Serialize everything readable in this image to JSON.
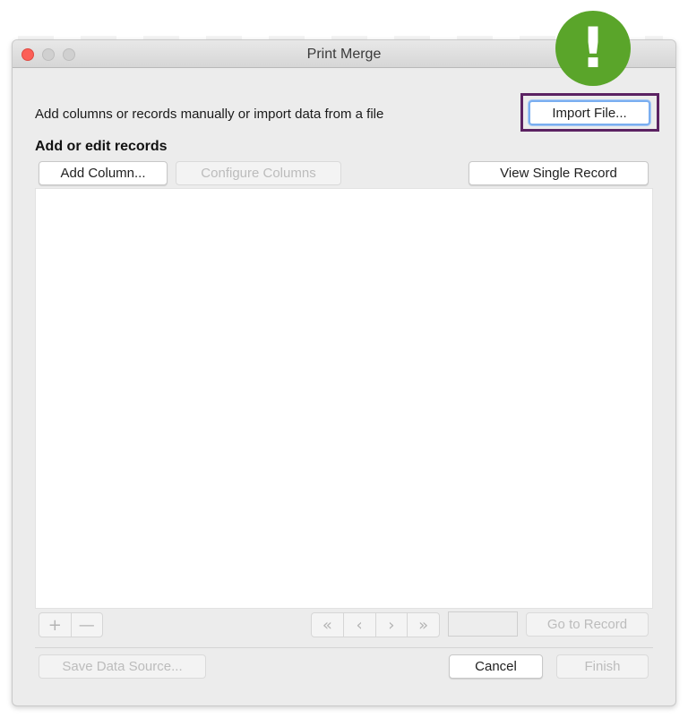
{
  "window": {
    "title": "Print Merge"
  },
  "intro_text": "Add columns or records manually or import data from a file",
  "import_button": "Import File...",
  "section_title": "Add or edit records",
  "toolbar": {
    "add_column": "Add Column...",
    "configure_columns": "Configure Columns",
    "view_single_record": "View Single Record"
  },
  "records_list": {
    "rows": []
  },
  "record_nav": {
    "add_symbol": "+",
    "remove_symbol": "—",
    "first_symbol": "«",
    "prev_symbol": "‹",
    "next_symbol": "›",
    "last_symbol": "»",
    "record_number_value": "",
    "go_to_record": "Go to Record"
  },
  "footer": {
    "save_data_source": "Save Data Source...",
    "cancel": "Cancel",
    "finish": "Finish"
  },
  "callout": {
    "icon": "exclamation-icon",
    "symbol": "!",
    "color": "#5aa52a",
    "highlight_color": "#5b2262"
  }
}
